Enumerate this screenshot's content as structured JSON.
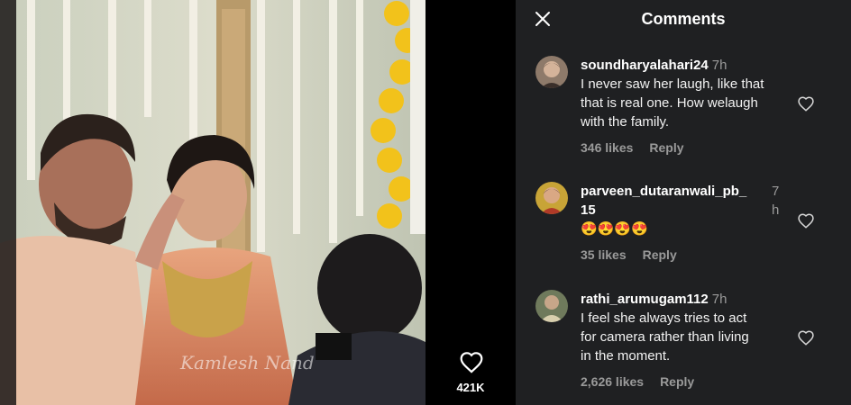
{
  "video": {
    "watermark": "Kamlesh Nand",
    "likes": "421K"
  },
  "panel": {
    "title": "Comments"
  },
  "comments": [
    {
      "user": "soundharyalahari24",
      "time": "7h",
      "text_lines": [
        "I never saw her laugh, like that",
        "that is real one. How welaugh",
        "with the family."
      ],
      "likes": "346 likes",
      "reply": "Reply"
    },
    {
      "user_line1": "parveen_dutaranwali_pb_",
      "user_line2": "15",
      "time_line1": "7",
      "time_line2": "h",
      "text": "😍😍😍😍",
      "likes": "35 likes",
      "reply": "Reply"
    },
    {
      "user": "rathi_arumugam112",
      "time": "7h",
      "text_lines": [
        "I feel she always tries to act",
        "for camera rather than living",
        "in the moment."
      ],
      "likes": "2,626 likes",
      "reply": "Reply"
    }
  ],
  "icons": {
    "close": "close-icon",
    "like": "heart-icon"
  },
  "colors": {
    "panel_bg": "#1f2022",
    "rail_bg": "#000000",
    "muted_text": "#9a9a9a"
  }
}
